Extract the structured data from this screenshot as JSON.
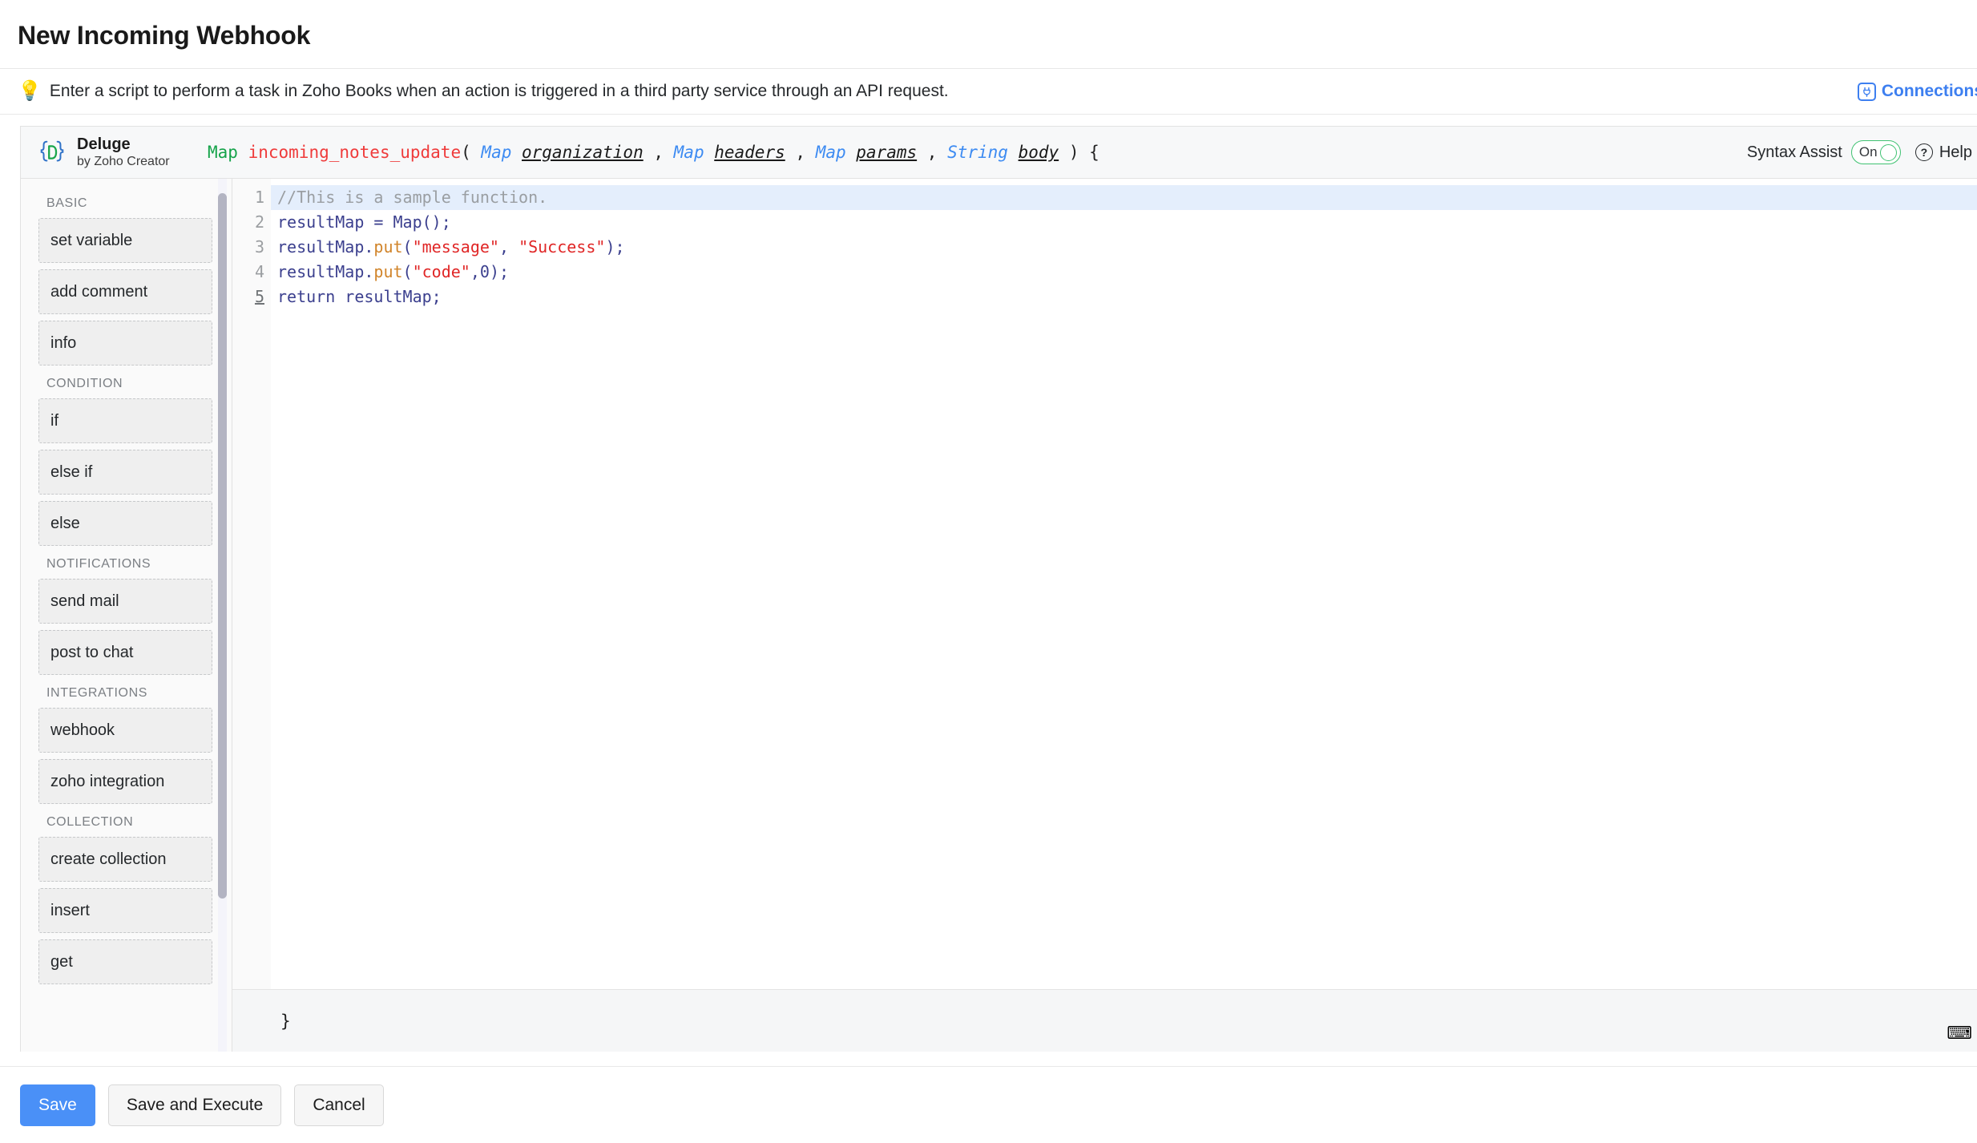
{
  "page": {
    "title": "New Incoming Webhook"
  },
  "hint": {
    "icon": "lightbulb-icon",
    "text": "Enter a script to perform a task in Zoho Books when an action is triggered in a third party service through an API request.",
    "connections_label": "Connections"
  },
  "editor": {
    "brand": {
      "name": "Deluge",
      "subtitle": "by Zoho Creator"
    },
    "signature": {
      "return_type": "Map",
      "function_name": "incoming_notes_update",
      "open_paren": "(",
      "params": [
        {
          "type": "Map",
          "name": "organization"
        },
        {
          "type": "Map",
          "name": "headers"
        },
        {
          "type": "Map",
          "name": "params"
        },
        {
          "type": "String",
          "name": "body"
        }
      ],
      "separator": ",",
      "close_paren": ")",
      "open_brace": "{"
    },
    "syntax_assist": {
      "label": "Syntax Assist",
      "state": "On"
    },
    "help": {
      "label": "Help",
      "symbol": "?"
    },
    "closing_brace": "}",
    "keyboard_icon": "keyboard-icon",
    "gutter": [
      "1",
      "2",
      "3",
      "4",
      "5"
    ],
    "active_line": 1,
    "cursor_line": 5,
    "code_lines": [
      {
        "number": "1",
        "tokens": [
          {
            "t": "comment",
            "v": "//This is a sample function."
          }
        ]
      },
      {
        "number": "2",
        "tokens": [
          {
            "t": "var",
            "v": "resultMap"
          },
          {
            "t": "op",
            "v": " = "
          },
          {
            "t": "type",
            "v": "Map"
          },
          {
            "t": "punct",
            "v": "();"
          }
        ]
      },
      {
        "number": "3",
        "tokens": [
          {
            "t": "var",
            "v": "resultMap"
          },
          {
            "t": "punct",
            "v": "."
          },
          {
            "t": "method",
            "v": "put"
          },
          {
            "t": "punct",
            "v": "("
          },
          {
            "t": "str",
            "v": "\"message\""
          },
          {
            "t": "punct",
            "v": ", "
          },
          {
            "t": "str",
            "v": "\"Success\""
          },
          {
            "t": "punct",
            "v": ");"
          }
        ]
      },
      {
        "number": "4",
        "tokens": [
          {
            "t": "var",
            "v": "resultMap"
          },
          {
            "t": "punct",
            "v": "."
          },
          {
            "t": "method",
            "v": "put"
          },
          {
            "t": "punct",
            "v": "("
          },
          {
            "t": "str",
            "v": "\"code\""
          },
          {
            "t": "punct",
            "v": ","
          },
          {
            "t": "num",
            "v": "0"
          },
          {
            "t": "punct",
            "v": ");"
          }
        ]
      },
      {
        "number": "5",
        "tokens": [
          {
            "t": "kw",
            "v": "return"
          },
          {
            "t": "var",
            "v": " resultMap"
          },
          {
            "t": "punct",
            "v": ";"
          }
        ]
      }
    ]
  },
  "palette": {
    "groups": [
      {
        "title": "BASIC",
        "items": [
          "set variable",
          "add comment",
          "info"
        ]
      },
      {
        "title": "CONDITION",
        "items": [
          "if",
          "else if",
          "else"
        ]
      },
      {
        "title": "NOTIFICATIONS",
        "items": [
          "send mail",
          "post to chat"
        ]
      },
      {
        "title": "INTEGRATIONS",
        "items": [
          "webhook",
          "zoho integration"
        ]
      },
      {
        "title": "COLLECTION",
        "items": [
          "create collection",
          "insert",
          "get"
        ]
      }
    ]
  },
  "actions": {
    "save": "Save",
    "save_and_execute": "Save and Execute",
    "cancel": "Cancel"
  },
  "colors": {
    "accent": "#4a90f7",
    "link": "#3d7ff0",
    "toggle_on": "#3fc272",
    "active_line": "#e4eefc"
  }
}
